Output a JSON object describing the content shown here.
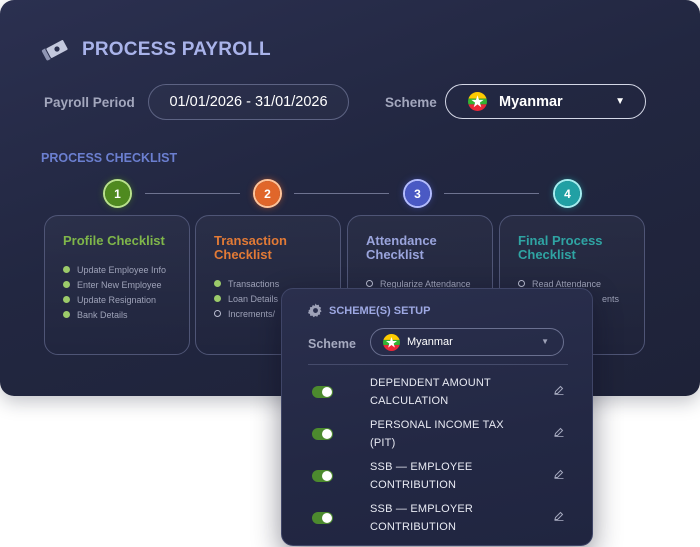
{
  "header": {
    "title": "PROCESS PAYROLL",
    "icon": "money-bills-icon"
  },
  "payroll_period": {
    "label": "Payroll Period",
    "value": "01/01/2026 - 31/01/2026"
  },
  "scheme": {
    "label": "Scheme",
    "value": "Myanmar",
    "flag_icon": "myanmar-flag-icon"
  },
  "checklist": {
    "title": "PROCESS CHECKLIST",
    "steps": [
      {
        "number": "1",
        "color": "#4f8a1f",
        "ring": "#b9e28c",
        "title_color": "#7fb64a"
      },
      {
        "number": "2",
        "color": "#e0662a",
        "ring": "#ffc49a",
        "title_color": "#e27a36"
      },
      {
        "number": "3",
        "color": "#4a59c4",
        "ring": "#b3bcff",
        "title_color": "#9aa4dc"
      },
      {
        "number": "4",
        "color": "#21a0a4",
        "ring": "#a5eef0",
        "title_color": "#2fa4a3"
      }
    ],
    "cards": [
      {
        "title": "Profile Checklist",
        "items": [
          {
            "label": "Update Employee Info",
            "done": true
          },
          {
            "label": "Enter New Employee",
            "done": true
          },
          {
            "label": "Update Resignation",
            "done": true
          },
          {
            "label": "Bank Details",
            "done": true
          }
        ]
      },
      {
        "title": "Transaction Checklist",
        "items": [
          {
            "label": "Transactions",
            "done": true
          },
          {
            "label": "Loan Details",
            "done": true
          },
          {
            "label": "Increments/",
            "done": false
          }
        ]
      },
      {
        "title": "Attendance Checklist",
        "items": [
          {
            "label": "Regularize Attendance",
            "done": false
          }
        ]
      },
      {
        "title": "Final Process Checklist",
        "items": [
          {
            "label": "Read Attendance",
            "done": false
          },
          {
            "label": "ents",
            "done": null
          }
        ]
      }
    ]
  },
  "scheme_setup": {
    "title": "SCHEME(S) SETUP",
    "icon": "gear-icon",
    "scheme_label": "Scheme",
    "scheme_value": "Myanmar",
    "rows": [
      {
        "label": "DEPENDENT AMOUNT CALCULATION",
        "enabled": true
      },
      {
        "label": "PERSONAL INCOME TAX (PIT)",
        "enabled": true
      },
      {
        "label": "SSB — EMPLOYEE CONTRIBUTION",
        "enabled": true
      },
      {
        "label": "SSB — EMPLOYER CONTRIBUTION",
        "enabled": true
      }
    ],
    "toggle_color": "#4c8a2e"
  },
  "colors": {
    "panel_bg": "#242946",
    "accent_title": "#a9b3ea",
    "checklist_title": "#6b7fd0"
  }
}
